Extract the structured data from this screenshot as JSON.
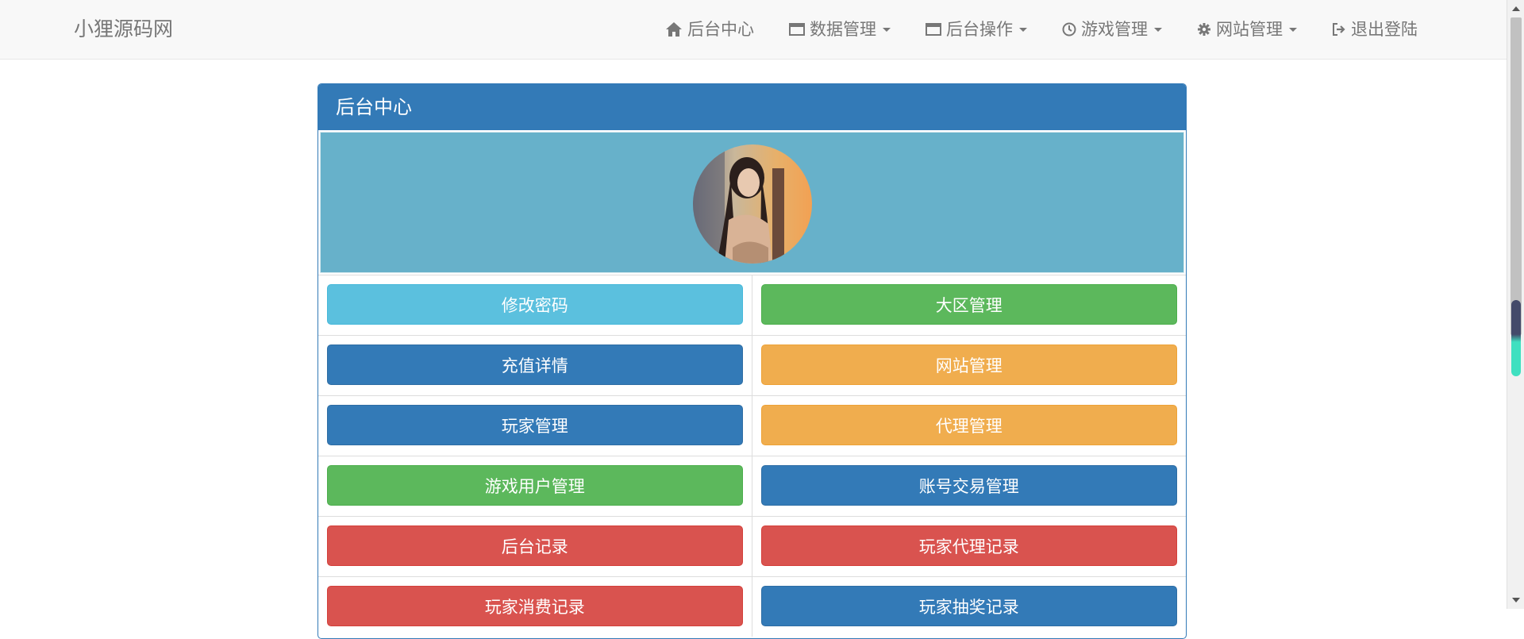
{
  "navbar": {
    "brand": "小狸源码网",
    "items": [
      {
        "icon": "home-icon",
        "label": "后台中心",
        "dropdown": false
      },
      {
        "icon": "window-icon",
        "label": "数据管理",
        "dropdown": true
      },
      {
        "icon": "window-icon",
        "label": "后台操作",
        "dropdown": true
      },
      {
        "icon": "clock-icon",
        "label": "游戏管理",
        "dropdown": true
      },
      {
        "icon": "gear-icon",
        "label": "网站管理",
        "dropdown": true
      },
      {
        "icon": "logout-icon",
        "label": "退出登陆",
        "dropdown": false
      }
    ]
  },
  "panel": {
    "title": "后台中心",
    "avatar": "user-avatar-photo",
    "buttons": [
      {
        "label": "修改密码",
        "style": "info"
      },
      {
        "label": "大区管理",
        "style": "success"
      },
      {
        "label": "充值详情",
        "style": "primary"
      },
      {
        "label": "网站管理",
        "style": "warning"
      },
      {
        "label": "玩家管理",
        "style": "primary"
      },
      {
        "label": "代理管理",
        "style": "warning"
      },
      {
        "label": "游戏用户管理",
        "style": "success"
      },
      {
        "label": "账号交易管理",
        "style": "primary"
      },
      {
        "label": "后台记录",
        "style": "danger"
      },
      {
        "label": "玩家代理记录",
        "style": "danger"
      },
      {
        "label": "玩家消费记录",
        "style": "danger"
      },
      {
        "label": "玩家抽奖记录",
        "style": "primary"
      }
    ]
  },
  "colors": {
    "primary": "#337ab7",
    "info": "#5bc0de",
    "success": "#5cb85c",
    "warning": "#f0ad4e",
    "danger": "#d9534f",
    "avatar_bg": "#67b1ca"
  }
}
